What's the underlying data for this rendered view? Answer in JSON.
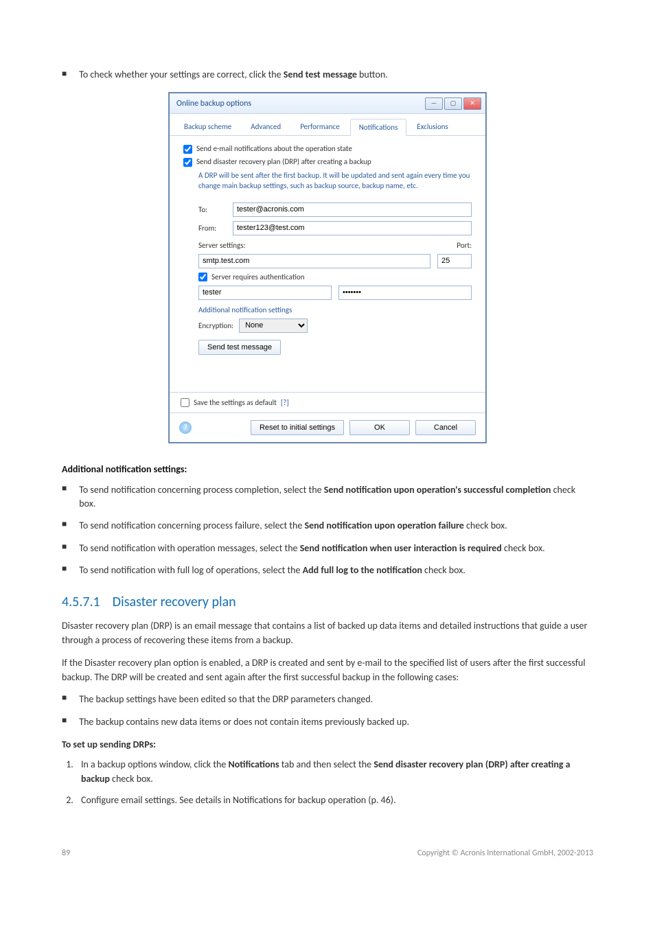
{
  "intro_text_before": "To check whether your settings are correct, click the ",
  "intro_text_bold": "Send test message",
  "intro_text_after": " button.",
  "dialog": {
    "title": "Online backup options",
    "tabs": [
      "Backup scheme",
      "Advanced",
      "Performance",
      "Notifications",
      "Exclusions"
    ],
    "active_tab": "Notifications",
    "chk1": "Send e-mail notifications about the operation state",
    "chk2": "Send disaster recovery plan (DRP) after creating a backup",
    "drp_note": "A DRP will be sent after the first backup. It will be updated and sent again every time you change main backup settings, such as backup source, backup name, etc.",
    "to_label": "To:",
    "to_value": "tester@acronis.com",
    "from_label": "From:",
    "from_value": "tester123@test.com",
    "server_settings_label": "Server settings:",
    "port_label": "Port:",
    "smtp_value": "smtp.test.com",
    "port_value": "25",
    "auth_label": "Server requires authentication",
    "cred_user": "tester",
    "cred_pass": "•••••••",
    "additional_header": "Additional notification settings",
    "encryption_label": "Encryption:",
    "encryption_value": "None",
    "send_test_btn": "Send test message",
    "save_default_label": "Save the settings as default",
    "save_default_hint": "[?]",
    "reset_btn": "Reset to initial settings",
    "ok_btn": "OK",
    "cancel_btn": "Cancel"
  },
  "addl_heading": "Additional notification settings:",
  "bullets": [
    {
      "pre": "To send notification concerning process completion, select the ",
      "bold": "Send notification upon operation's successful completion",
      "post": " check box."
    },
    {
      "pre": "To send notification concerning process failure, select the ",
      "bold": "Send notification upon operation failure",
      "post": " check box."
    },
    {
      "pre": "To send notification with operation messages, select the ",
      "bold": "Send notification when user interaction is required",
      "post": " check box."
    },
    {
      "pre": "To send notification with full log of operations, select the ",
      "bold": "Add full log to the notification",
      "post": " check box."
    }
  ],
  "section_number": "4.5.7.1",
  "section_title": "Disaster recovery plan",
  "para1": "Disaster recovery plan (DRP) is an email message that contains a list of backed up data items and detailed instructions that guide a user through a process of recovering these items from a backup.",
  "para2": "If the Disaster recovery plan option is enabled, a DRP is created and sent by e-mail to the specified list of users after the first successful backup. The DRP will be created and sent again after the first successful backup in the following cases:",
  "cases": [
    "The backup settings have been edited so that the DRP parameters changed.",
    "The backup contains new data items or does not contain items previously backed up."
  ],
  "setup_heading": "To set up sending DRPs:",
  "steps": [
    {
      "pre": "In a backup options window, click the ",
      "b1": "Notifications",
      "mid": " tab and then select the ",
      "b2": "Send disaster recovery plan (DRP) after creating a backup",
      "post": " check box."
    },
    {
      "pre": "Configure email settings. See details in Notifications for backup operation (p. 46).",
      "b1": "",
      "mid": "",
      "b2": "",
      "post": ""
    }
  ],
  "page_number": "89",
  "copyright": "Copyright © Acronis International GmbH, 2002-2013"
}
